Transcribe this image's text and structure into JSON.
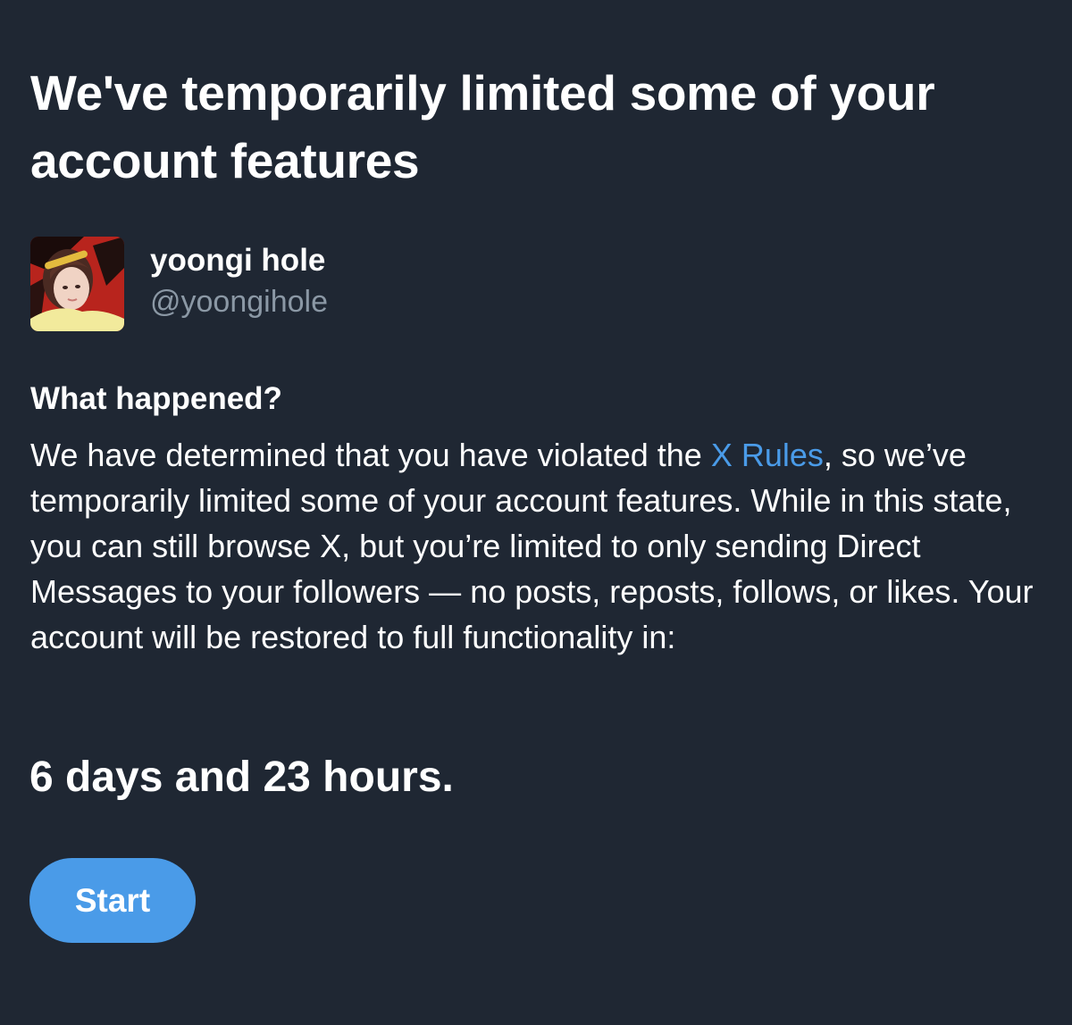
{
  "page": {
    "title": "We've temporarily limited some of your account features",
    "background_color": "#1f2733"
  },
  "profile": {
    "display_name": "yoongi hole",
    "handle": "@yoongihole",
    "avatar_icon": "profile-photo"
  },
  "details": {
    "heading": "What happened?",
    "body_before_link": "We have determined that you have violated the ",
    "rules_link": "X Rules",
    "body_after_link": ", so we’ve temporarily limited some of your account features. While in this state, you can still browse X, but you’re limited to only sending Direct Messages to your followers — no posts, reposts, follows, or likes. Your account will be restored to full functionality in:",
    "link_color": "#4a9be8"
  },
  "countdown": {
    "text": "6 days and 23 hours."
  },
  "actions": {
    "start_label": "Start",
    "button_color": "#4a9be8"
  }
}
